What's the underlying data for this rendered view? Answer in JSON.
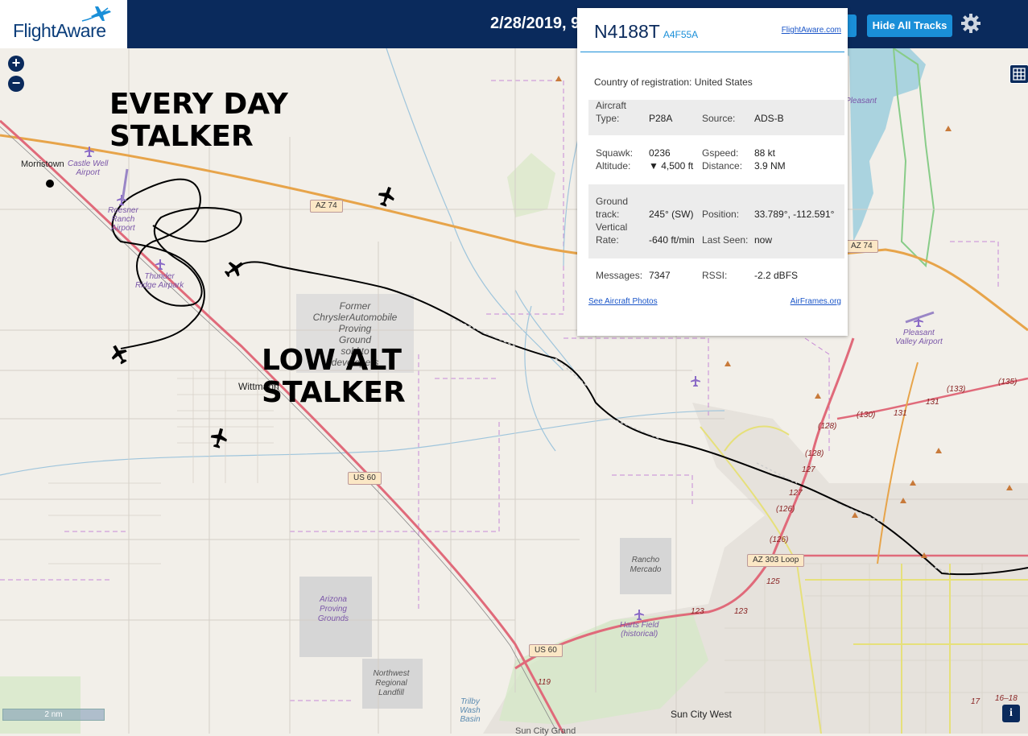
{
  "app": {
    "logo_text": "FlightAware",
    "date_time": "2/28/2019, 9"
  },
  "toolbar": {
    "hide_tracks_label": "Hide All Tracks"
  },
  "map_controls": {
    "zoom_in": "+",
    "zoom_out": "−",
    "info": "i",
    "scale": "2 nm"
  },
  "annotations": {
    "every_day_1": "EVERY DAY",
    "every_day_2": "STALKER",
    "low_alt_1": "LOW ALT",
    "low_alt_2": "STALKER"
  },
  "popup": {
    "registration": "N4188T",
    "hex": "A4F55A",
    "link": "FlightAware.com",
    "country_label": "Country of registration:",
    "country": "United States",
    "aircraft_type_label_1": "Aircraft",
    "aircraft_type_label_2": "Type:",
    "aircraft_type": "P28A",
    "source_label": "Source:",
    "source": "ADS-B",
    "squawk_label": "Squawk:",
    "squawk": "0236",
    "altitude_label": "Altitude:",
    "altitude": "▼ 4,500 ft",
    "gspeed_label": "Gspeed:",
    "gspeed": "88 kt",
    "distance_label": "Distance:",
    "distance": "3.9 NM",
    "ground_track_label_1": "Ground",
    "ground_track_label_2": "track:",
    "ground_track": "245° (SW)",
    "position_label": "Position:",
    "position": "33.789°, -112.591°",
    "vrate_label_1": "Vertical",
    "vrate_label_2": "Rate:",
    "vrate": "-640 ft/min",
    "last_seen_label": "Last Seen:",
    "last_seen": "now",
    "messages_label": "Messages:",
    "messages": "7347",
    "rssi_label": "RSSI:",
    "rssi": "-2.2 dBFS",
    "photos_link": "See Aircraft Photos",
    "airframes_link": "AirFrames.org"
  },
  "map_labels": {
    "morristown": "Morristown",
    "wittmann": "Wittmann",
    "sun_city_west": "Sun City West",
    "sun_city_grand": "Sun City Grand",
    "castle_well": "Castle Well Airport",
    "castle_well_1": "Castle Well",
    "castle_well_2": "Airport",
    "roesner_1": "Roesner",
    "roesner_2": "Ranch",
    "roesner_3": "Airport",
    "thunder_1": "Thunder",
    "thunder_2": "Ridge Airpark",
    "pleasant_1": "Pleasant",
    "pleasant_2": "Valley Airport",
    "pleasant_top": "Pleasant",
    "harts_1": "Harts Field",
    "harts_2": "(historical)",
    "former_1": "Former",
    "former_2": "ChryslerAutomobile",
    "former_3": "Proving",
    "former_4": "Ground",
    "former_5": "sold to",
    "former_6": "developers",
    "arizona_1": "Arizona",
    "arizona_2": "Proving",
    "arizona_3": "Grounds",
    "nw_1": "Northwest",
    "nw_2": "Regional",
    "nw_3": "Landfill",
    "rancho_1": "Rancho",
    "rancho_2": "Mercado",
    "trilby_1": "Trilby",
    "trilby_2": "Wash",
    "trilby_3": "Basin",
    "az74": "AZ 74",
    "az74b": "AZ 74",
    "us60a": "US 60",
    "us60b": "US 60",
    "az303": "AZ 303 Loop",
    "h135": "(135)",
    "h133": "(133)",
    "h131a": "131",
    "h131b": "131",
    "h130": "(130)",
    "h128a": "(128)",
    "h128b": "(128)",
    "h127a": "127",
    "h127b": "127",
    "h126a": "(126)",
    "h126b": "(126)",
    "h125": "125",
    "h123a": "123",
    "h123b": "123",
    "h119": "119",
    "h17": "17",
    "h1618": "16–18"
  },
  "colors": {
    "header": "#0a2a5c",
    "accent": "#1a8fd8",
    "map_bg": "#f2efe9",
    "highway": "#e7a44a",
    "major_road": "#e06a7a"
  }
}
